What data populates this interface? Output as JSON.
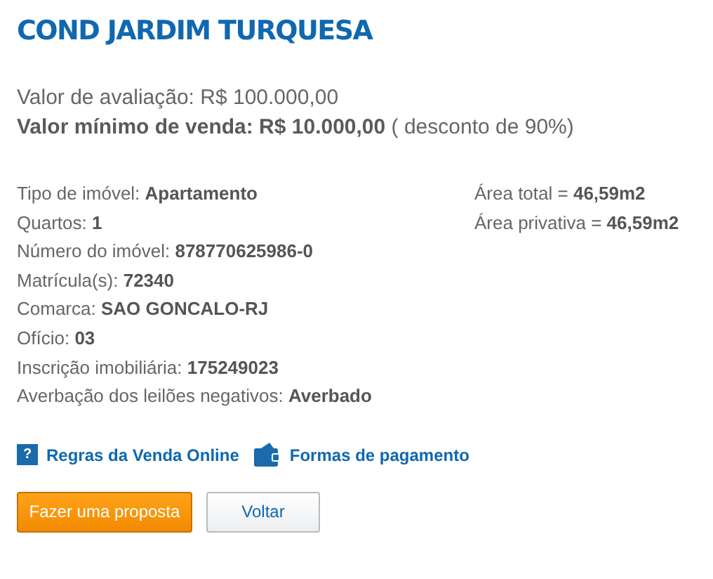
{
  "title": "COND JARDIM TURQUESA",
  "valuation": "Valor de avaliação: R$ 100.000,00",
  "minimum": "**Valor mínimo de venda: R$ 10.000,00** ( desconto de 90%)",
  "details": [
    {
      "label": "Tipo de imóvel:",
      "value": "Apartamento"
    },
    {
      "label": "Quartos:",
      "value": "1"
    },
    {
      "label": "Número do imóvel:",
      "value": "878770625986-0"
    },
    {
      "label": "Matrícula(s):",
      "value": "72340"
    },
    {
      "label": "Comarca:",
      "value": "SAO GONCALO-RJ"
    },
    {
      "label": "Ofício:",
      "value": "03"
    },
    {
      "label": "Inscrição imobiliária:",
      "value": "175249023"
    },
    {
      "label": "Averbação dos leilões negativos:",
      "value": "Averbado"
    }
  ],
  "areas": [
    {
      "label": "Área total =",
      "value": "46,59m2"
    },
    {
      "label": "Área privativa =",
      "value": "46,59m2"
    }
  ],
  "links": [
    {
      "kind": "help",
      "icon_glyph": "?",
      "label": "Regras da Venda Online"
    },
    {
      "kind": "wallet",
      "label": "Formas de pagamento"
    }
  ],
  "buttons": [
    {
      "kind": "primary",
      "label": "Fazer uma proposta"
    },
    {
      "kind": "secondary",
      "label": "Voltar"
    }
  ]
}
